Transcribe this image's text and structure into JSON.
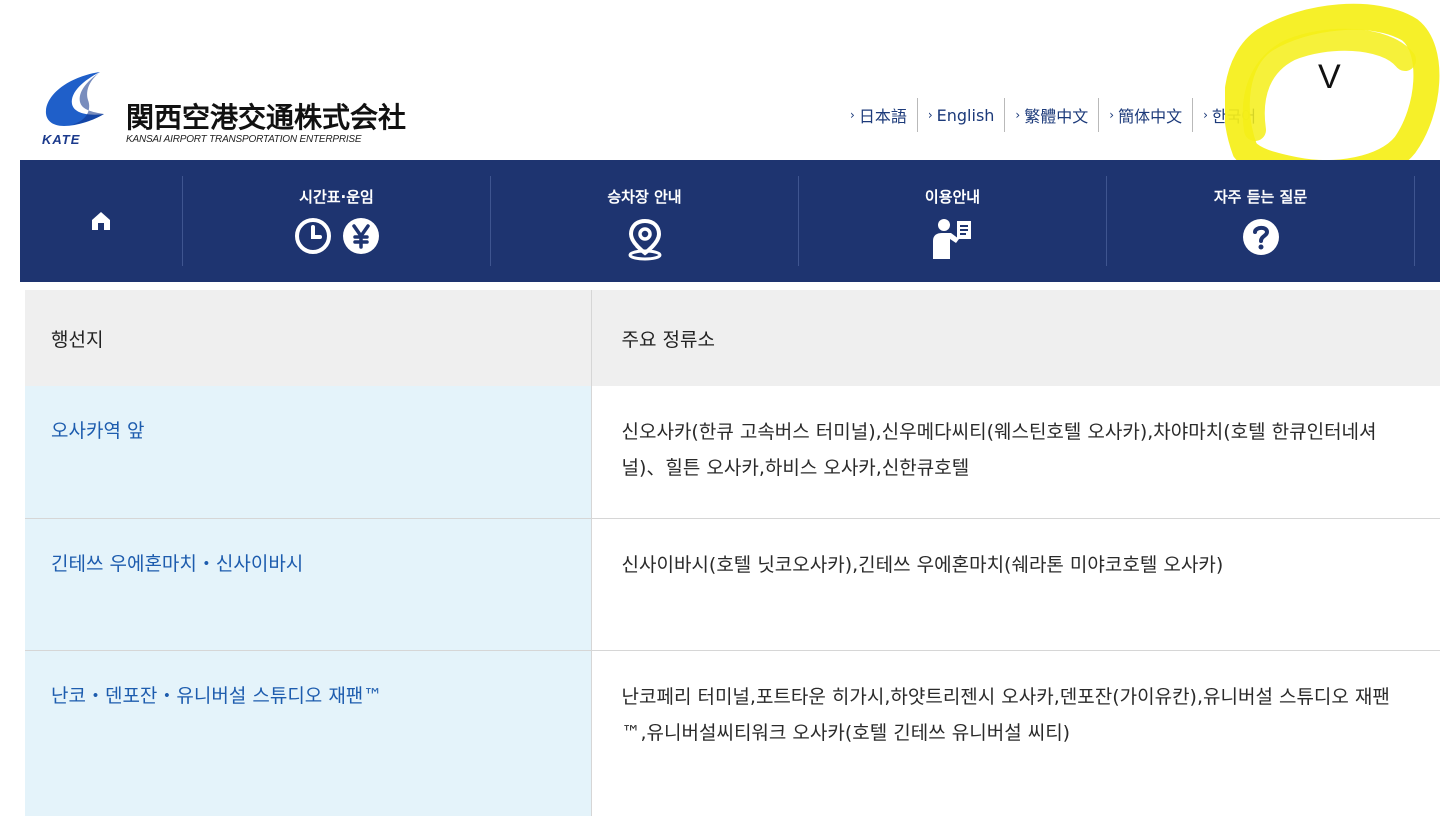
{
  "header": {
    "logo_name": "関西空港交通株式会社",
    "logo_abbr": "KATE",
    "logo_sub": "KANSAI AIRPORT TRANSPORTATION ENTERPRISE",
    "brand_color": "#1e3470",
    "languages": [
      {
        "label": "日本語"
      },
      {
        "label": "English"
      },
      {
        "label": "繁體中文"
      },
      {
        "label": "簡体中文"
      },
      {
        "label": "한국어"
      }
    ],
    "annotation_mark": "V"
  },
  "nav": {
    "items": [
      {
        "label": "",
        "icon": "home-icon"
      },
      {
        "label": "시간표·운임",
        "icon": "clock-yen-icon"
      },
      {
        "label": "승차장 안내",
        "icon": "map-pin-icon"
      },
      {
        "label": "이용안내",
        "icon": "guide-person-icon"
      },
      {
        "label": "자주 듣는 질문",
        "icon": "question-icon"
      }
    ]
  },
  "table": {
    "headers": [
      "행선지",
      "주요 정류소"
    ],
    "rows": [
      {
        "destination": "오사카역 앞",
        "stops": "신오사카(한큐 고속버스 터미널),신우메다씨티(웨스틴호텔 오사카),차야마치(호텔 한큐인터네셔널)、힐튼 오사카,하비스 오사카,신한큐호텔"
      },
      {
        "destination": "긴테쓰 우에혼마치・신사이바시",
        "stops": "신사이바시(호텔 닛코오사카),긴테쓰 우에혼마치(쉐라톤 미야코호텔 오사카)"
      },
      {
        "destination": "난코・덴포잔・유니버설 스튜디오 재팬™",
        "stops": "난코페리 터미널,포트타운 히가시,하얏트리젠시 오사카,덴포잔(가이유칸),유니버설 스튜디오 재팬™,유니버설씨티워크 오사카(호텔 긴테쓰 유니버설 씨티)"
      }
    ]
  }
}
